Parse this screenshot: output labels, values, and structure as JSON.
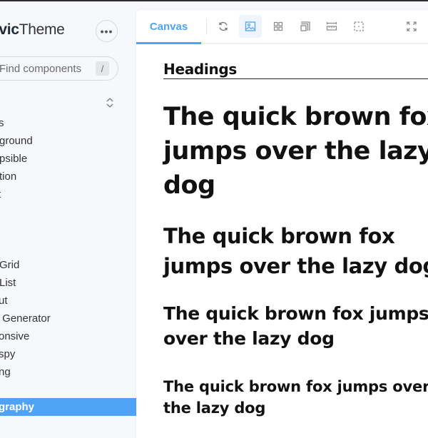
{
  "app": {
    "brand_bold": "Civic",
    "brand_regular": "Theme",
    "more_label": "•••"
  },
  "sidebar": {
    "search_placeholder": "Find components",
    "search_shortcut": "/",
    "items": [
      {
        "label": "Icons",
        "visible": "s"
      },
      {
        "label": "Background",
        "visible": "ground"
      },
      {
        "label": "Collapsible",
        "visible": "psible"
      },
      {
        "label": "Animation",
        "visible": "tion"
      },
      {
        "label": "Content",
        "visible": "t"
      },
      {
        "label": "Grid",
        "visible": "Grid"
      },
      {
        "label": "Item List",
        "visible": "List"
      },
      {
        "label": "Layout",
        "visible": "ut"
      },
      {
        "label": "Color Generator",
        "visible": " Generator"
      },
      {
        "label": "Responsive",
        "visible": "onsive"
      },
      {
        "label": "Scrollspy",
        "visible": "spy"
      },
      {
        "label": "Spacing",
        "visible": "ng"
      },
      {
        "label": "Typography",
        "visible": "graphy",
        "active": true
      }
    ]
  },
  "toolbar": {
    "tab_canvas": "Canvas",
    "tools": [
      {
        "name": "reload-icon",
        "active": false
      },
      {
        "name": "image-background-icon",
        "active": true
      },
      {
        "name": "grid-icon",
        "active": false
      },
      {
        "name": "outline-icon",
        "active": false
      },
      {
        "name": "measure-icon",
        "active": false
      },
      {
        "name": "viewport-icon",
        "active": false
      },
      {
        "name": "fullscreen-icon",
        "active": false
      }
    ]
  },
  "canvas": {
    "section_title": "Headings",
    "h1": [
      "The quick brown fox",
      "jumps over the lazy",
      "dog"
    ],
    "h2": [
      "The quick brown fox",
      "jumps over the lazy dog"
    ],
    "h3": [
      "The quick brown fox jumps",
      "over the lazy dog"
    ],
    "h4": [
      "The quick brown fox jumps over",
      "the lazy dog"
    ]
  },
  "colors": {
    "accent": "#4fa3f7",
    "sidebar_bg": "#f6f8fb",
    "text": "#111111"
  }
}
